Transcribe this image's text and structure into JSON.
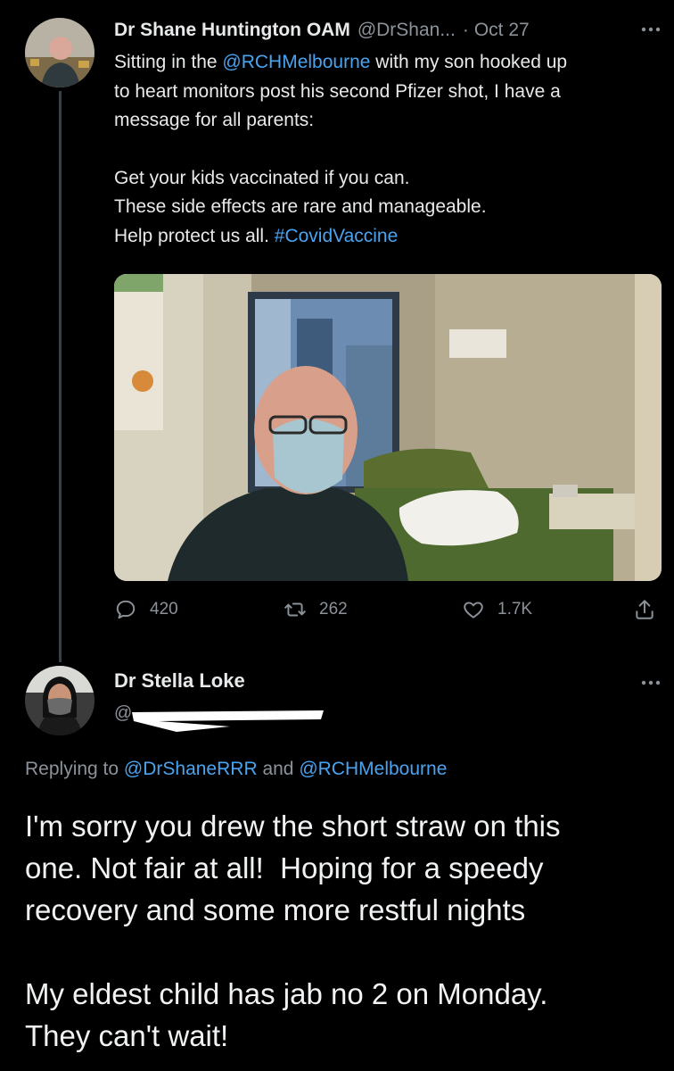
{
  "tweet": {
    "name": "Dr Shane Huntington OAM",
    "handle": "@DrShan...",
    "separator": "·",
    "date": "Oct 27",
    "more_icon": "ellipsis-icon",
    "text_prefix": "Sitting in the ",
    "mention": "@RCHMelbourne",
    "text_line1_rest": " with my son hooked up",
    "text_line2": "to heart monitors post his second Pfizer shot, I have a",
    "text_line3": "message for all parents:",
    "text_line4": "Get your kids vaccinated if you can.",
    "text_line5": "These side effects are rare and manageable.",
    "text_line6_prefix": "Help protect us all. ",
    "hashtag": "#CovidVaccine",
    "replies": "420",
    "retweets": "262",
    "likes": "1.7K"
  },
  "reply": {
    "name": "Dr Stella Loke",
    "handle_visible": "@",
    "more_icon": "ellipsis-icon",
    "replying_prefix": "Replying to ",
    "replying_user1": "@DrShaneRRR",
    "replying_and": " and ",
    "replying_user2": "@RCHMelbourne",
    "line1": "I'm sorry you drew the short straw on this",
    "line2": "one. Not fair at all!  Hoping for a speedy",
    "line3": "recovery and some more restful nights",
    "line4": "My eldest child has jab no 2 on Monday.",
    "line5": "They can't wait!"
  },
  "colors": {
    "background": "#000000",
    "text": "#e7e9ea",
    "muted": "#8b9299",
    "link": "#4aa3ef"
  }
}
